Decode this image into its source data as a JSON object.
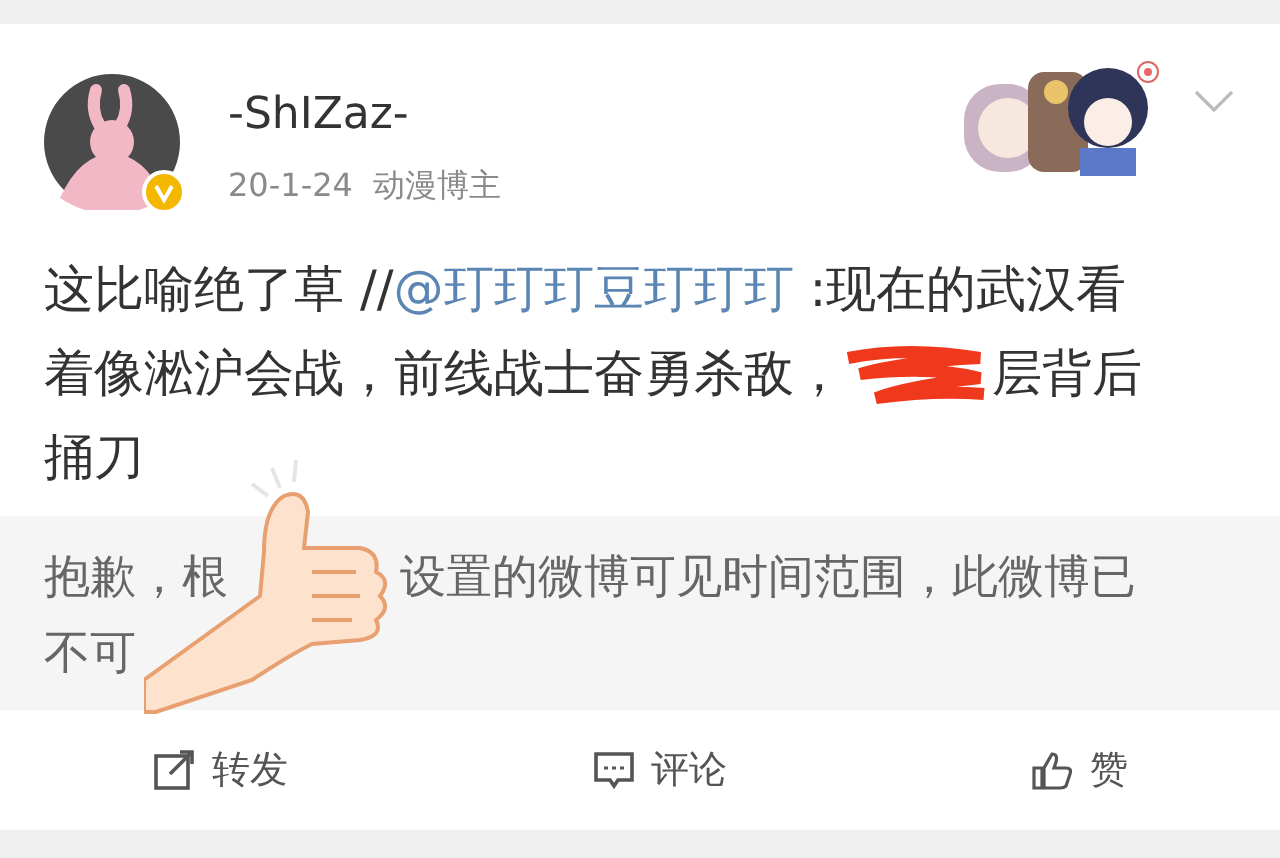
{
  "post": {
    "author": "-ShIZaz-",
    "verified": true,
    "date": "20-1-24",
    "author_tag": "动漫博主",
    "text_before": "这比喻绝了草 //",
    "mention": "@玎玎玎豆玎玎玎",
    "text_after": " :现在的武汉看着像淞沪会战，前线战士奋勇杀敌，",
    "text_end": "层背后捅刀"
  },
  "notice": {
    "line1_start": "抱歉，根",
    "line1_end": "设置的微博可见时间范围，此微博已",
    "line2": "不可"
  },
  "actions": [
    {
      "kind": "repost",
      "label": "转发"
    },
    {
      "kind": "comment",
      "label": "评论"
    },
    {
      "kind": "like",
      "label": "赞"
    }
  ]
}
